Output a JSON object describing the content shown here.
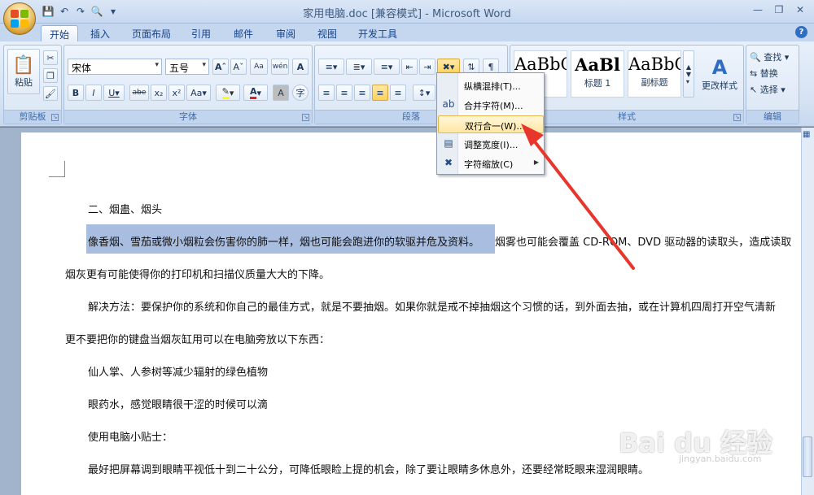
{
  "window": {
    "title": "家用电脑.doc [兼容模式] - Microsoft Word"
  },
  "colors": {
    "accent": "#2f6dc4",
    "selection": "#a9bde0",
    "menu_highlight": "#ffe7a3",
    "arrow": "#e8362d"
  },
  "qat": {
    "save_icon": "save-icon",
    "undo_icon": "undo-icon",
    "redo_icon": "redo-icon",
    "print_preview_icon": "print-preview-icon",
    "customize_icon": "customize-icon"
  },
  "tabs": [
    {
      "label": "开始"
    },
    {
      "label": "插入"
    },
    {
      "label": "页面布局"
    },
    {
      "label": "引用"
    },
    {
      "label": "邮件"
    },
    {
      "label": "审阅"
    },
    {
      "label": "视图"
    },
    {
      "label": "开发工具"
    }
  ],
  "ribbon": {
    "clipboard": {
      "label": "剪贴板",
      "paste": "粘贴"
    },
    "font": {
      "label": "字体",
      "font_name": "宋体",
      "font_size": "五号"
    },
    "paragraph": {
      "label": "段落"
    },
    "styles": {
      "label": "样式",
      "items": [
        {
          "preview": "AaBbC",
          "name": "题"
        },
        {
          "preview": "AaBl",
          "name": "标题 1"
        },
        {
          "preview": "AaBbC",
          "name": "副标题"
        }
      ],
      "change_styles": "更改样式"
    },
    "editing": {
      "label": "编辑",
      "find": "查找",
      "replace": "替换",
      "select": "选择"
    }
  },
  "menu": {
    "items": [
      {
        "label": "纵横混排(T)..."
      },
      {
        "label": "合并字符(M)..."
      },
      {
        "label": "双行合一(W)..."
      },
      {
        "label": "调整宽度(I)..."
      },
      {
        "label": "字符缩放(C)"
      }
    ]
  },
  "document": {
    "lines": [
      "二、烟蛊、烟头",
      "像香烟、雪茄或微小烟粒会伤害你的肺一样，烟也可能会跑进你的软驱并危及资料。",
      "烟雾也可能会覆盖 CD-ROM、DVD 驱动器的读取头，造成读取",
      "烟灰更有可能使得你的打印机和扫描仪质量大大的下降。",
      "解决方法：要保护你的系统和你自己的最佳方式，就是不要抽烟。如果你就是戒不掉抽烟这个习惯的话，到外面去抽，或在计算机四周打开空气清新",
      "更不要把你的键盘当烟灰缸用可以在电脑旁放以下东西：",
      "仙人掌、人参树等减少辐射的绿色植物",
      "眼药水，感觉眼睛很干涩的时候可以滴",
      "使用电脑小贴士：",
      "最好把屏幕调到眼睛平视低十到二十公分，可降低眼睑上提的机会，除了要让眼睛多休息外，还要经常眨眼来湿润眼睛。"
    ]
  },
  "watermark": {
    "main": "Bai du 经验",
    "sub": "jingyan.baidu.com"
  }
}
